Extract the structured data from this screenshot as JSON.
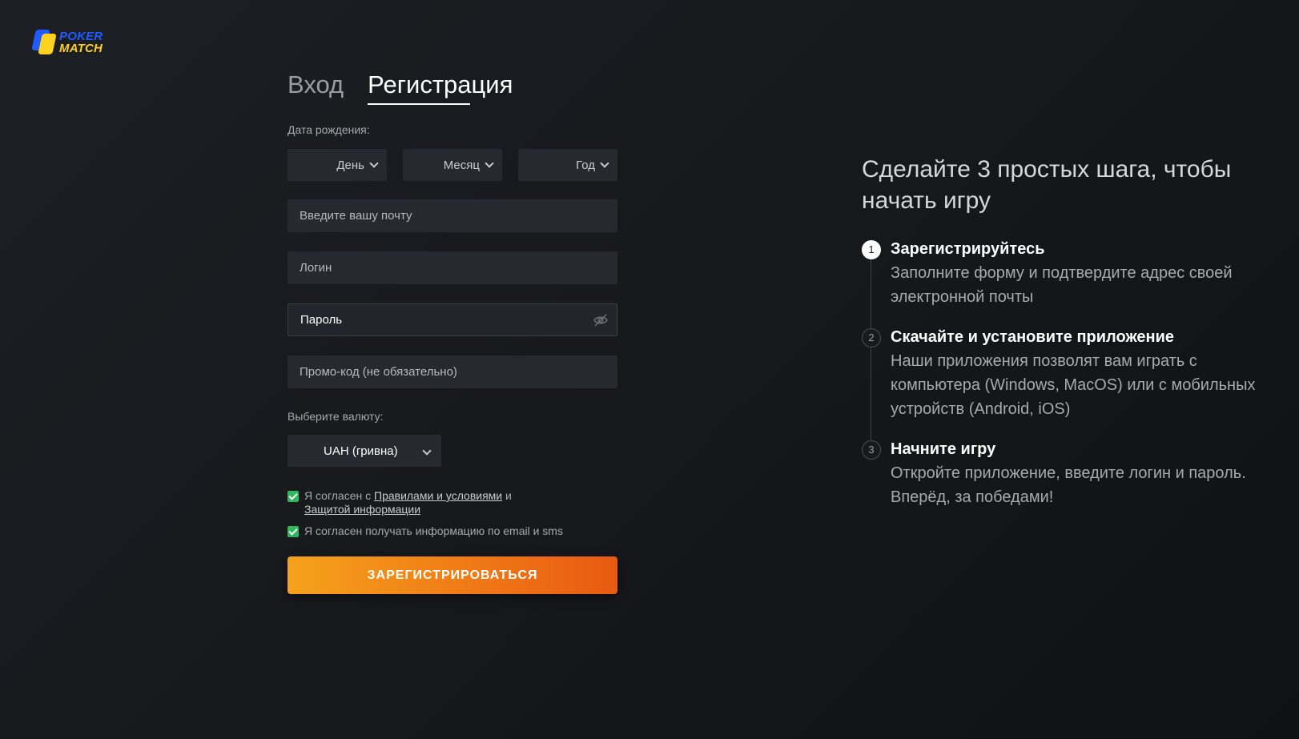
{
  "logo": {
    "line1": "POKER",
    "line2": "MATCH"
  },
  "tabs": {
    "login": "Вход",
    "register": "Регистрация"
  },
  "form": {
    "dob_label": "Дата рождения:",
    "day": "День",
    "month": "Месяц",
    "year": "Год",
    "email_placeholder": "Введите вашу почту",
    "login_placeholder": "Логин",
    "password_value": "Пароль",
    "promo_placeholder": "Промо-код (не обязательно)",
    "currency_label": "Выберите валюту:",
    "currency_value": "UAH (гривна)",
    "terms": {
      "prefix": "Я согласен с ",
      "rules_link": "Правилами и условиями",
      "middle": " и",
      "privacy_link": "Защитой информации"
    },
    "newsletter": "Я согласен получать информацию по email и sms",
    "submit": "ЗАРЕГИСТРИРОВАТЬСЯ"
  },
  "steps_panel": {
    "title": "Сделайте 3 простых шага, чтобы начать игру",
    "steps": [
      {
        "num": "1",
        "title": "Зарегистрируйтесь",
        "text": "Заполните форму и подтвердите адрес своей электронной почты"
      },
      {
        "num": "2",
        "title": "Скачайте и установите приложение",
        "text": "Наши приложения позволят вам играть с компьютера (Windows, MacOS) или с мобильных устройств (Android, iOS)"
      },
      {
        "num": "3",
        "title": "Начните игру",
        "text": "Откройте приложение, введите логин и пароль. Вперёд, за победами!"
      }
    ]
  },
  "colors": {
    "accent_orange": "#f07a16",
    "check_green": "#2db85c",
    "logo_blue": "#1f5bff",
    "logo_yellow": "#ffd21f"
  }
}
